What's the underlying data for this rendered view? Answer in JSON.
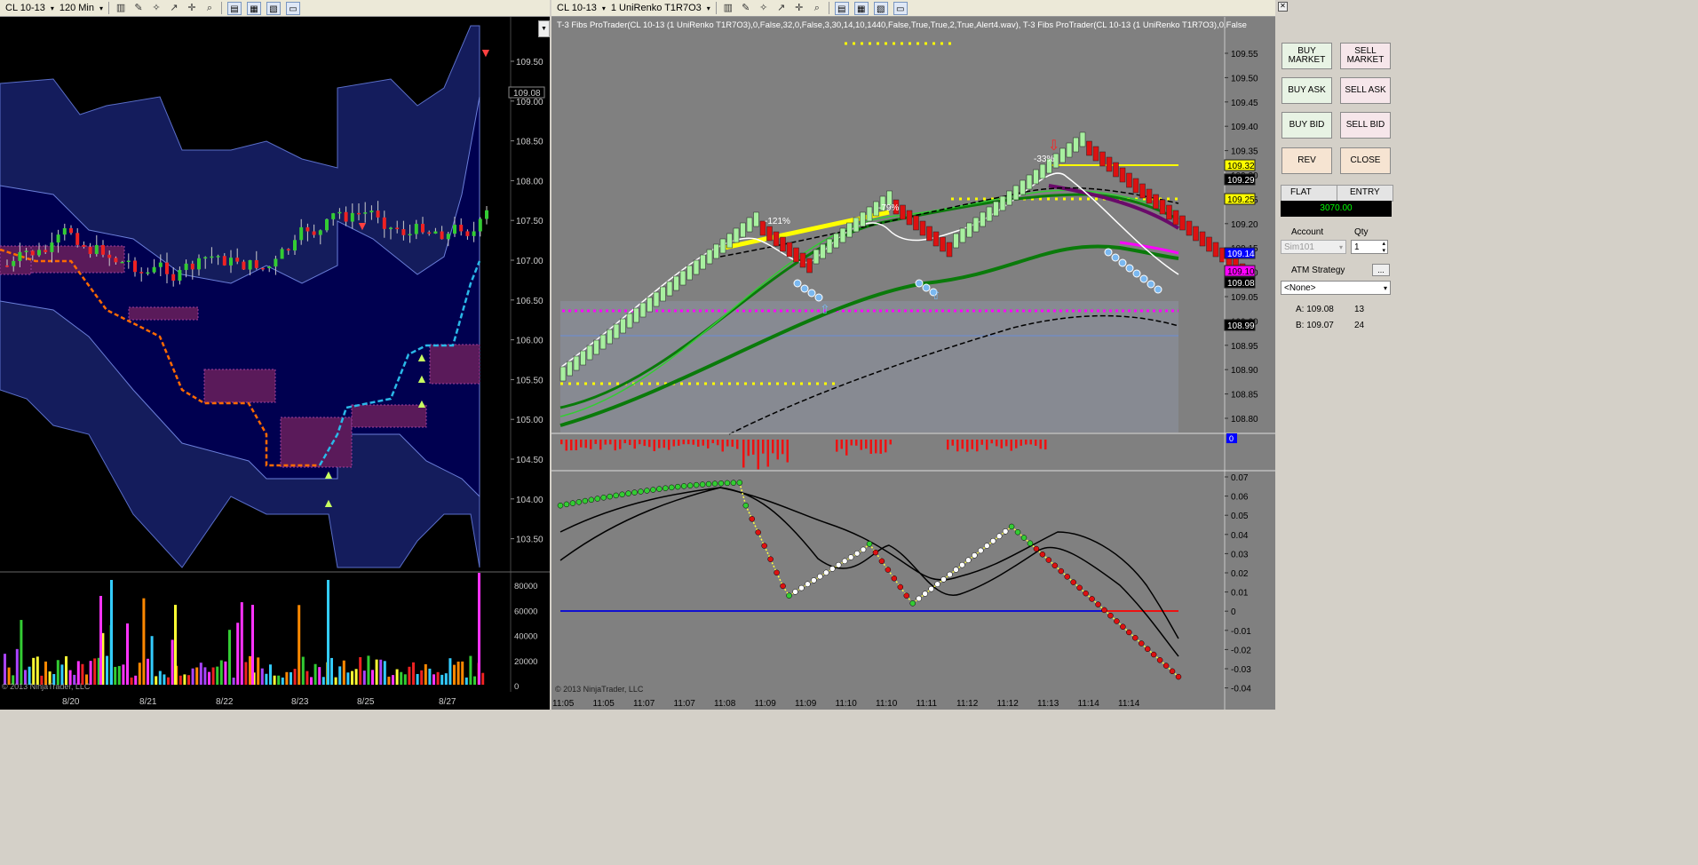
{
  "left_chart": {
    "instrument": "CL 10-13",
    "interval": "120 Min",
    "price_labels": [
      "109.50",
      "109.00",
      "108.50",
      "108.00",
      "107.50",
      "107.00",
      "106.50",
      "106.00",
      "105.50",
      "105.00",
      "104.50",
      "104.00",
      "103.50"
    ],
    "current_price": "109.08",
    "volume_labels": [
      "80000",
      "60000",
      "40000",
      "20000",
      "0"
    ],
    "date_labels": [
      "8/20",
      "8/21",
      "8/22",
      "8/23",
      "8/25",
      "8/27"
    ],
    "copyright": "© 2013 NinjaTrader, LLC"
  },
  "right_chart": {
    "instrument": "CL 10-13",
    "interval": "1 UniRenko T1R7O3",
    "indicator_label": "T-3 Fibs ProTrader(CL 10-13 (1 UniRenko T1R7O3),0,False,32,0,False,3,30,14,10,1440,False,True,True,2,True,Alert4.wav),  T-3 Fibs ProTrader(CL 10-13 (1 UniRenko T1R7O3),0,False",
    "price_labels": [
      "109.55",
      "109.50",
      "109.45",
      "109.40",
      "109.35",
      "109.30",
      "109.25",
      "109.20",
      "109.15",
      "109.10",
      "109.05",
      "109.00",
      "108.95",
      "108.90",
      "108.85",
      "108.80"
    ],
    "tags": [
      {
        "text": "109.32",
        "color": "#ffff00",
        "fg": "#000000"
      },
      {
        "text": "109.29",
        "color": "#000000",
        "fg": "#ffffff"
      },
      {
        "text": "109.25",
        "color": "#ffff00",
        "fg": "#000000"
      },
      {
        "text": "109.14",
        "color": "#0000ff",
        "fg": "#ffffff"
      },
      {
        "text": "109.10",
        "color": "#ff00ff",
        "fg": "#000000"
      },
      {
        "text": "109.08",
        "color": "#000000",
        "fg": "#ffffff"
      },
      {
        "text": "108.99",
        "color": "#000000",
        "fg": "#ffffff"
      }
    ],
    "histogram_tag": "0",
    "annotations": [
      "-121%",
      "-79%",
      "-33%"
    ],
    "osc_labels": [
      "0.07",
      "0.06",
      "0.05",
      "0.04",
      "0.03",
      "0.02",
      "0.01",
      "0",
      "-0.01",
      "-0.02",
      "-0.03",
      "-0.04"
    ],
    "time_labels": [
      "11:05",
      "11:05",
      "11:07",
      "11:07",
      "11:08",
      "11:09",
      "11:09",
      "11:10",
      "11:10",
      "11:11",
      "11:12",
      "11:12",
      "11:13",
      "11:14",
      "11:14"
    ],
    "copyright": "© 2013 NinjaTrader, LLC"
  },
  "order_panel": {
    "buy_market": "BUY MARKET",
    "sell_market": "SELL MARKET",
    "buy_ask": "BUY ASK",
    "sell_ask": "SELL ASK",
    "buy_bid": "BUY BID",
    "sell_bid": "SELL BID",
    "rev": "REV",
    "close": "CLOSE",
    "position": "FLAT",
    "entry_label": "ENTRY",
    "pnl": "3070.00",
    "account_label": "Account",
    "qty_label": "Qty",
    "account_value": "Sim101",
    "qty_value": "1",
    "atm_label": "ATM Strategy",
    "atm_more": "...",
    "atm_value": "<None>",
    "ask_label": "A: 109.08",
    "ask_size": "13",
    "bid_label": "B: 109.07",
    "bid_size": "24",
    "colors": {
      "pnl_bg": "#000000",
      "pnl_fg": "#00ff00",
      "buy": "#e8f3e4",
      "sell": "#f6e6ea"
    }
  }
}
